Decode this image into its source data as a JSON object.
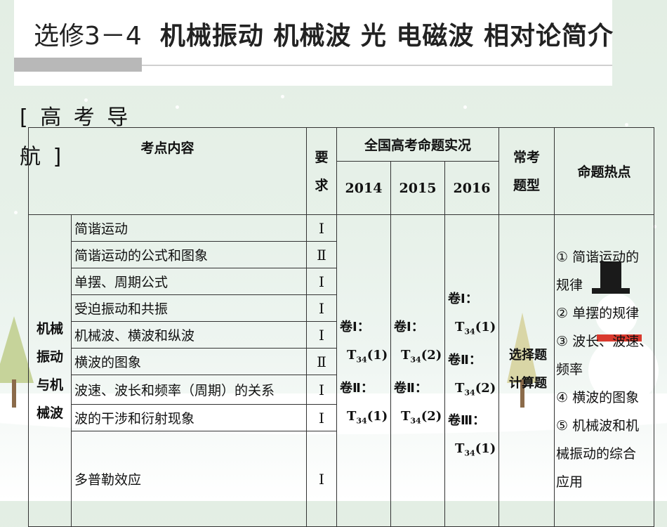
{
  "title": {
    "sub": "选修3－4",
    "main": "机械振动  机械波  光  电磁波  相对论简介"
  },
  "nav_label": "[ 高 考 导 航 ]",
  "table": {
    "headers": {
      "content": "考点内容",
      "requirement_line1": "要",
      "requirement_line2": "求",
      "exam_group": "全国高考命题实况",
      "years": [
        "2014",
        "2015",
        "2016"
      ],
      "type_line1": "常考",
      "type_line2": "题型",
      "hot": "命题热点"
    },
    "category": [
      "机械",
      "振动",
      "与机",
      "械波"
    ],
    "rows": [
      {
        "item": "简谐运动",
        "req": "Ⅰ"
      },
      {
        "item": "简谐运动的公式和图象",
        "req": "Ⅱ"
      },
      {
        "item": "单摆、周期公式",
        "req": "Ⅰ"
      },
      {
        "item": "受迫振动和共振",
        "req": "Ⅰ"
      },
      {
        "item": "机械波、横波和纵波",
        "req": "Ⅰ"
      },
      {
        "item": "横波的图象",
        "req": "Ⅱ"
      },
      {
        "item": "波速、波长和频率（周期）的关系",
        "req": "Ⅰ"
      },
      {
        "item": "波的干涉和衍射现象",
        "req": "Ⅰ"
      },
      {
        "item": "多普勒效应",
        "req": "Ⅰ"
      }
    ],
    "y2014": {
      "v1": "卷Ⅰ：",
      "t1": "T",
      "s1": "34",
      "p1": "(1)",
      "v2": "卷Ⅱ：",
      "t2": "T",
      "s2": "34",
      "p2": "(1)"
    },
    "y2015": {
      "v1": "卷Ⅰ：",
      "t1": "T",
      "s1": "34",
      "p1": "(2)",
      "v2": "卷Ⅱ：",
      "t2": "T",
      "s2": "34",
      "p2": "(2)"
    },
    "y2016": {
      "v1": "卷Ⅰ：",
      "t1": "T",
      "s1": "34",
      "p1": "(1)",
      "v2": "卷Ⅱ：",
      "t2": "T",
      "s2": "34",
      "p2": "(2)",
      "v3": "卷Ⅲ：",
      "t3": "T",
      "s3": "34",
      "p3": "(1)"
    },
    "types": [
      "选择题",
      "计算题"
    ],
    "hot_points": [
      "① 简谐运动的",
      "规律",
      "② 单摆的规律",
      "③ 波长、波速、",
      "频率",
      "④ 横波的图象",
      "⑤ 机械波和机",
      "械振动的综合",
      "应用"
    ]
  }
}
